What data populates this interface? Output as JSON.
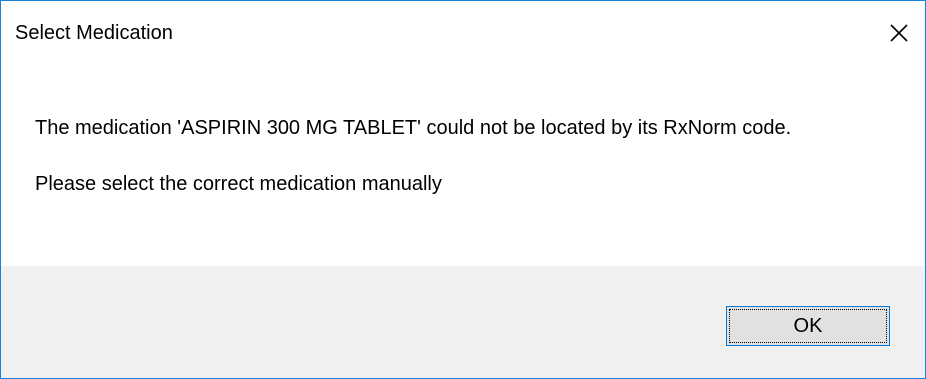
{
  "dialog": {
    "title": "Select Medication",
    "close_icon": "close-icon",
    "message_line1": "The medication 'ASPIRIN 300 MG TABLET' could not be located by its RxNorm code.",
    "message_line2": "Please select the correct medication manually",
    "ok_label": "OK"
  },
  "colors": {
    "border": "#1883d7",
    "footer_bg": "#f0f0f0",
    "button_bg": "#e1e1e1",
    "button_border": "#0078d7"
  }
}
